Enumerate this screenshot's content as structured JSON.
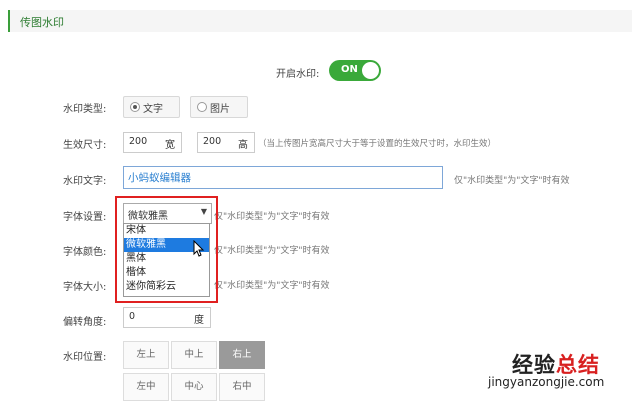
{
  "section": {
    "title": "传图水印"
  },
  "toggle": {
    "label": "开启水印:",
    "state": "ON"
  },
  "type": {
    "label": "水印类型:",
    "options": [
      "文字",
      "图片"
    ],
    "selected": "文字"
  },
  "size": {
    "label": "生效尺寸:",
    "width_value": "200",
    "width_unit": "宽",
    "height_value": "200",
    "height_unit": "高",
    "hint": "（当上传图片宽高尺寸大于等于设置的生效尺寸时，水印生效）"
  },
  "text": {
    "label": "水印文字:",
    "value": "小蚂蚁编辑器",
    "hint": "仅\"水印类型\"为\"文字\"时有效"
  },
  "font": {
    "label": "字体设置:",
    "selected": "微软雅黑",
    "caret": "▼",
    "hint": "仅\"水印类型\"为\"文字\"时有效",
    "options": [
      "宋体",
      "微软雅黑",
      "黑体",
      "楷体",
      "迷你简彩云"
    ]
  },
  "color": {
    "label": "字体颜色:",
    "hint": "仅\"水印类型\"为\"文字\"时有效"
  },
  "fontsize": {
    "label": "字体大小:",
    "hint": "仅\"水印类型\"为\"文字\"时有效"
  },
  "rotate": {
    "label": "偏转角度:",
    "value": "0",
    "unit": "度"
  },
  "position": {
    "label": "水印位置:",
    "cells": [
      "左上",
      "中上",
      "右上",
      "左中",
      "中心",
      "右中"
    ],
    "selected": "右上"
  },
  "watermark": {
    "line1_a": "经验",
    "line1_b": "总结",
    "url": "jingyanzongjie.com"
  }
}
